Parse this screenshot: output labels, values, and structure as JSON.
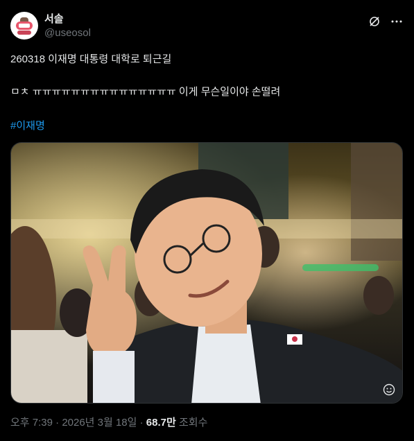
{
  "author": {
    "display_name": "서솔",
    "handle": "@useosol"
  },
  "post": {
    "line1": "260318 이재명 대통령 대학로 퇴근길",
    "line2": "ㅁㅊ ㅠㅠㅠㅠㅠㅠㅠㅠㅠㅠㅠㅠㅠㅠㅠ 이게 무슨일이야 손떨려",
    "hashtag": "#이재명"
  },
  "media": {
    "icons": [
      "grok-icon",
      "more-icon",
      "emoji-badge-icon"
    ]
  },
  "footer": {
    "time": "오후 7:39",
    "separator": "·",
    "date": "2026년 3월 18일",
    "views_count": "68.7만",
    "views_label": "조회수"
  },
  "colors": {
    "background": "#000000",
    "text": "#e7e9ea",
    "muted": "#71767b",
    "link": "#1d9bf0"
  }
}
